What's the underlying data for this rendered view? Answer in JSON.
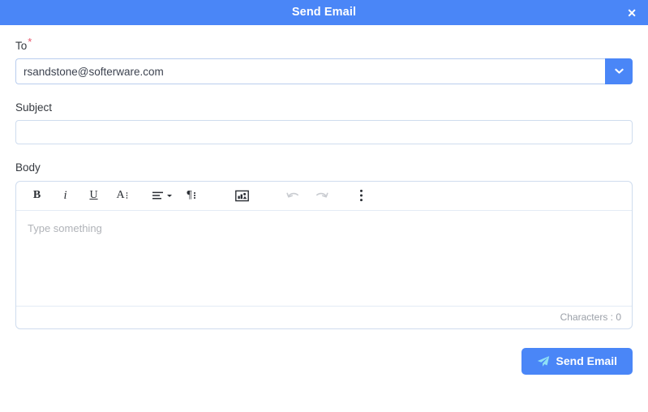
{
  "header": {
    "title": "Send Email",
    "close_label": "✕"
  },
  "form": {
    "to": {
      "label": "To",
      "required_marker": "*",
      "value": "rsandstone@softerware.com",
      "placeholder": "",
      "dropdown_icon": "chevron-down-icon"
    },
    "subject": {
      "label": "Subject",
      "value": "",
      "placeholder": ""
    },
    "body": {
      "label": "Body",
      "placeholder": "Type something",
      "character_count_label": "Characters : 0"
    }
  },
  "toolbar": {
    "items": [
      {
        "name": "bold-icon",
        "glyph": "B",
        "disabled": false
      },
      {
        "name": "italic-icon",
        "glyph": "i",
        "disabled": false
      },
      {
        "name": "underline-icon",
        "glyph": "U",
        "disabled": false
      },
      {
        "name": "font-options-icon",
        "glyph": "A",
        "disabled": false
      },
      {
        "name": "align-icon",
        "glyph": "",
        "disabled": false
      },
      {
        "name": "paragraph-icon",
        "glyph": "¶",
        "disabled": false
      },
      {
        "name": "insert-image-icon",
        "glyph": "",
        "disabled": false
      },
      {
        "name": "undo-icon",
        "glyph": "",
        "disabled": true
      },
      {
        "name": "redo-icon",
        "glyph": "",
        "disabled": true
      },
      {
        "name": "more-options-icon",
        "glyph": "",
        "disabled": false
      }
    ]
  },
  "footer": {
    "send_label": "Send Email",
    "send_icon": "paper-plane-icon"
  },
  "colors": {
    "accent": "#4a86f7",
    "required": "#e8566b",
    "border": "#cfdcee",
    "placeholder": "#b0b3b8",
    "plane_icon": "#8fe0f5"
  }
}
